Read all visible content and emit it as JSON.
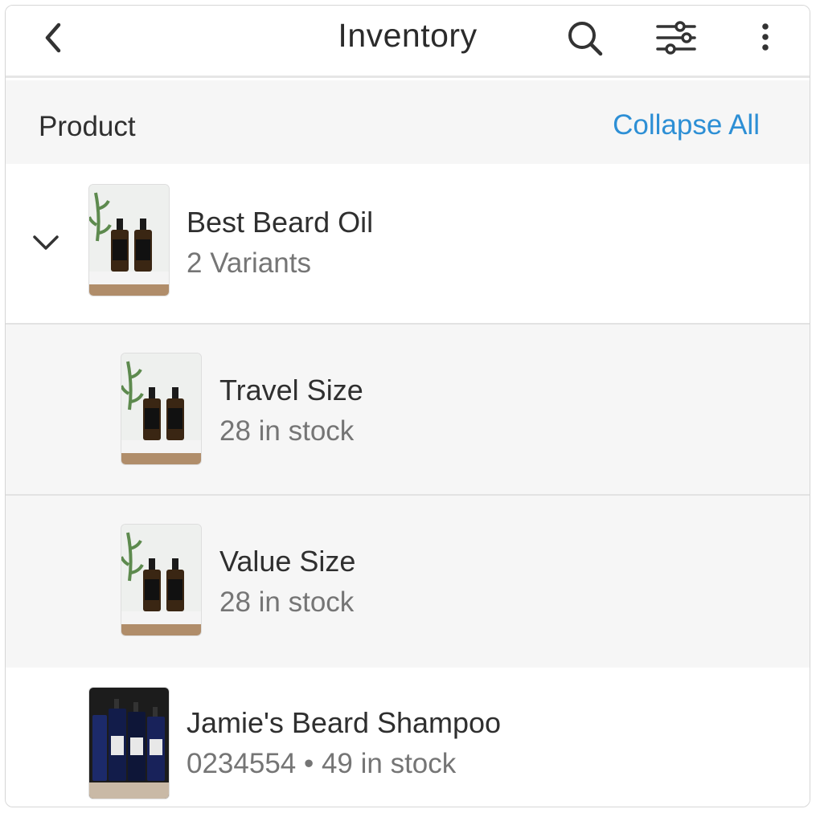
{
  "header": {
    "title": "Inventory",
    "icons": [
      "back-icon",
      "search-icon",
      "filter-icon",
      "more-icon"
    ]
  },
  "list_header": {
    "label": "Product",
    "action": "Collapse All",
    "action_color": "#2d8fd5"
  },
  "products": [
    {
      "name": "Best Beard Oil",
      "subtitle": "2 Variants",
      "expanded": true,
      "variants": [
        {
          "name": "Travel Size",
          "subtitle": "28 in stock"
        },
        {
          "name": "Value Size",
          "subtitle": "28 in stock"
        }
      ]
    },
    {
      "name": "Jamie's Beard Shampoo",
      "subtitle": "0234554 • 49 in stock"
    }
  ]
}
